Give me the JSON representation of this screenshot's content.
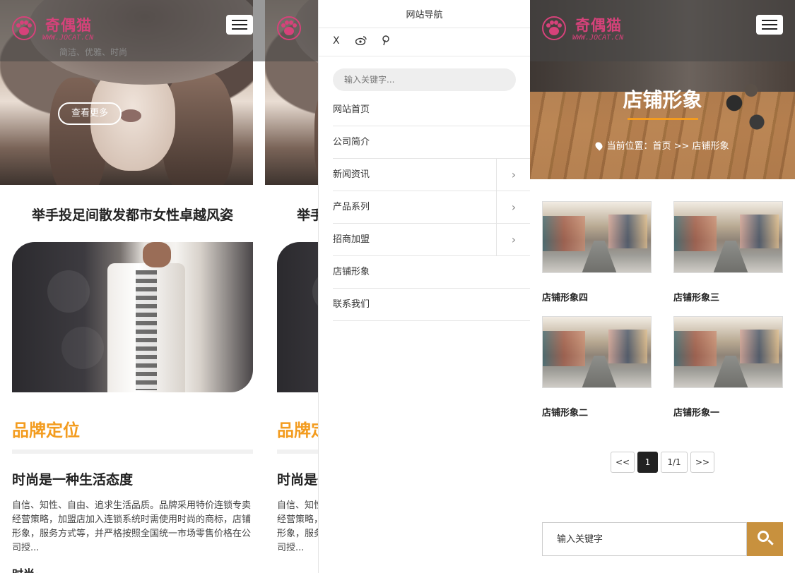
{
  "brand": {
    "name": "奇偶猫",
    "url": "WWW.JOCAT.CN",
    "slogan": "简洁、优雅、时尚"
  },
  "home": {
    "hero_button": "查看更多",
    "main_title": "举手投足间散发都市女性卓越风姿",
    "section_title": "品牌定位",
    "sub_title": "时尚是一种生活态度",
    "body_text": "自信、知性、自由、追求生活品质。品牌采用特价连锁专卖经营策略，加盟店加入连锁系统时需使用时尚的商标，店铺形象，服务方式等，并严格按照全国统一市场零售价格在公司授...",
    "next_title": "时尚·…"
  },
  "drawer": {
    "title": "网站导航",
    "social": [
      "X",
      "weibo-icon",
      "pinterest-icon"
    ],
    "search_placeholder": "输入关键字...",
    "items": [
      {
        "label": "网站首页",
        "has_sub": false
      },
      {
        "label": "公司简介",
        "has_sub": false
      },
      {
        "label": "新闻资讯",
        "has_sub": true
      },
      {
        "label": "产品系列",
        "has_sub": true
      },
      {
        "label": "招商加盟",
        "has_sub": true
      },
      {
        "label": "店铺形象",
        "has_sub": false
      },
      {
        "label": "联系我们",
        "has_sub": false
      }
    ]
  },
  "store": {
    "banner_title": "店铺形象",
    "crumb_prefix": "当前位置：",
    "crumb_path": "首页 >> 店铺形象",
    "items": [
      "店铺形象四",
      "店铺形象三",
      "店铺形象二",
      "店铺形象一"
    ],
    "pager": {
      "prev": "<<",
      "current": "1",
      "total": "1/1",
      "next": ">>"
    },
    "search_placeholder": "输入关键字"
  },
  "colors": {
    "accent": "#f39c1f",
    "search_btn": "#c8913e",
    "logo": "#d6427a"
  }
}
